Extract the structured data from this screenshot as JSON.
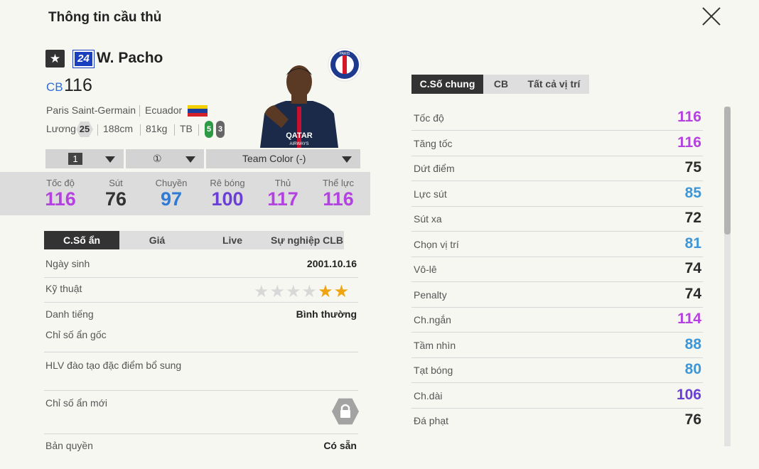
{
  "header": {
    "title": "Thông tin cầu thủ"
  },
  "player": {
    "star_glyph": "★",
    "season_badge": "24",
    "name": "W. Pacho",
    "position": "CB",
    "overall": "116",
    "club": "Paris Saint-Germain",
    "nation": "Ecuador",
    "salary_label": "Lương",
    "salary": "25",
    "height": "188cm",
    "weight": "81kg",
    "body_type": "TB",
    "right_foot": "5",
    "left_foot": "3",
    "flag_colors": [
      "#f5d000",
      "#1c3f9e",
      "#d62028"
    ],
    "club_logo_text": "PARIS",
    "shirt_sponsor": "QATAR",
    "shirt_sponsor_sub": "AIRWAYS"
  },
  "dropdowns": [
    {
      "value": "1",
      "name": "upgrade-dropdown"
    },
    {
      "value": "①",
      "name": "team-skill-dropdown"
    },
    {
      "value": "Team Color (-)",
      "name": "team-color-dropdown"
    }
  ],
  "summary_stats": [
    {
      "label": "Tốc độ",
      "value": "116",
      "color": "#b442e0"
    },
    {
      "label": "Sút",
      "value": "76",
      "color": "#333333"
    },
    {
      "label": "Chuyền",
      "value": "97",
      "color": "#2f7ad4"
    },
    {
      "label": "Rê bóng",
      "value": "100",
      "color": "#6a3fd6"
    },
    {
      "label": "Thủ",
      "value": "117",
      "color": "#b442e0"
    },
    {
      "label": "Thể lực",
      "value": "116",
      "color": "#b442e0"
    }
  ],
  "left_tabs": [
    "C.Số ẩn",
    "Giá",
    "Live",
    "Sự nghiệp CLB"
  ],
  "details": {
    "birth_label": "Ngày sinh",
    "birth_value": "2001.10.16",
    "skill_label": "Kỹ thuật",
    "skill_stars": 2,
    "skill_stars_total": 6,
    "reputation_label": "Danh tiếng",
    "reputation_value": "Bình thường",
    "hidden_stats_label": "Chỉ số ẩn gốc",
    "coach_label": "HLV đào tạo đặc điểm bổ sung",
    "new_hidden_label": "Chỉ số ẩn mới",
    "license_label": "Bản quyền",
    "license_value": "Có sẵn"
  },
  "right_tabs": [
    "C.Số chung",
    "CB",
    "Tất cả vị trí"
  ],
  "attributes": [
    {
      "label": "Tốc độ",
      "value": "116",
      "color": "#b442e0"
    },
    {
      "label": "Tăng tốc",
      "value": "116",
      "color": "#b442e0"
    },
    {
      "label": "Dứt điểm",
      "value": "75",
      "color": "#2b2b2b"
    },
    {
      "label": "Lực sút",
      "value": "85",
      "color": "#3b97d9"
    },
    {
      "label": "Sút xa",
      "value": "72",
      "color": "#2b2b2b"
    },
    {
      "label": "Chọn vị trí",
      "value": "81",
      "color": "#3b97d9"
    },
    {
      "label": "Vô-lê",
      "value": "74",
      "color": "#2b2b2b"
    },
    {
      "label": "Penalty",
      "value": "74",
      "color": "#2b2b2b"
    },
    {
      "label": "Ch.ngắn",
      "value": "114",
      "color": "#b442e0"
    },
    {
      "label": "Tầm nhìn",
      "value": "88",
      "color": "#3b97d9"
    },
    {
      "label": "Tạt bóng",
      "value": "80",
      "color": "#3b97d9"
    },
    {
      "label": "Ch.dài",
      "value": "106",
      "color": "#6a3fd6"
    },
    {
      "label": "Đá phạt",
      "value": "76",
      "color": "#2b2b2b"
    }
  ]
}
